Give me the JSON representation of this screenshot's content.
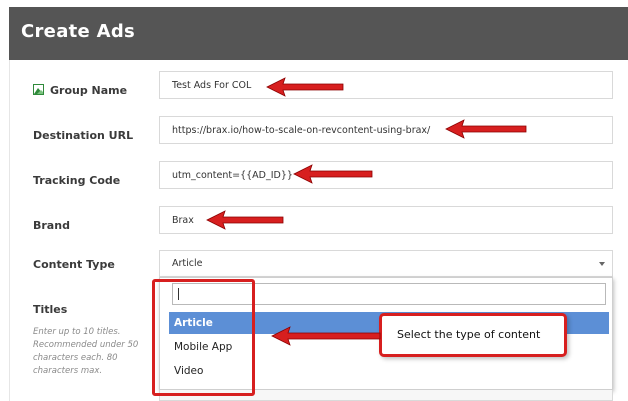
{
  "header": {
    "title": "Create Ads"
  },
  "form": {
    "group_name": {
      "label": "Group Name",
      "value": "Test Ads For COL"
    },
    "destination_url": {
      "label": "Destination URL",
      "value": "https://brax.io/how-to-scale-on-revcontent-using-brax/"
    },
    "tracking_code": {
      "label": "Tracking Code",
      "value": "utm_content={{AD_ID}}"
    },
    "brand": {
      "label": "Brand",
      "value": "Brax"
    },
    "content_type": {
      "label": "Content Type",
      "value": "Article"
    },
    "titles": {
      "label": "Titles",
      "help": "Enter up to 10 titles. Recommended under 50 characters each. 80 characters max."
    }
  },
  "dropdown": {
    "search_value": "",
    "options": [
      "Article",
      "Mobile App",
      "Video"
    ],
    "selected": "Article"
  },
  "annotation": {
    "callout_text": "Select the type of content"
  },
  "colors": {
    "header_bg": "#555555",
    "highlight": "#5c8fd6",
    "annotation_red": "#d71f1f"
  },
  "icons": {
    "group_name_icon": "image-icon"
  }
}
